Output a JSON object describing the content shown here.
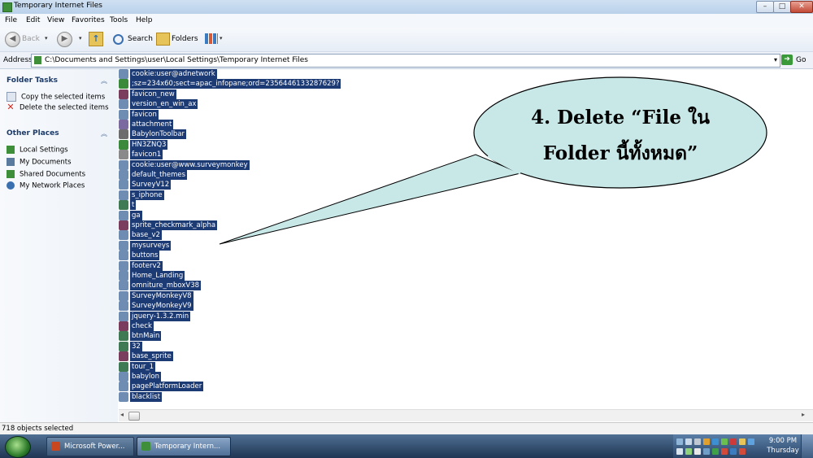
{
  "window": {
    "title": "Temporary Internet Files",
    "minimize_glyph": "–",
    "maximize_glyph": "□",
    "close_glyph": "✕"
  },
  "menu": [
    "File",
    "Edit",
    "View",
    "Favorites",
    "Tools",
    "Help"
  ],
  "toolbar": {
    "back_label": "Back",
    "back_glyph": "◀",
    "forward_glyph": "▶",
    "up_glyph": "↑",
    "search_label": "Search",
    "folders_label": "Folders",
    "dropdown_glyph": "▾"
  },
  "address": {
    "label": "Address",
    "value": "C:\\Documents and Settings\\user\\Local Settings\\Temporary Internet Files",
    "dropdown_glyph": "▾",
    "go_label": "Go",
    "go_glyph": "➜"
  },
  "left_pane": {
    "folder_tasks": {
      "title": "Folder Tasks",
      "chevron": "︽",
      "items": [
        {
          "label": "Copy the selected items",
          "icon": "copy-icon"
        },
        {
          "label": "Delete the selected items",
          "icon": "delete-icon"
        }
      ]
    },
    "other_places": {
      "title": "Other Places",
      "chevron": "︽",
      "items": [
        {
          "label": "Local Settings",
          "icon": "folder-icon"
        },
        {
          "label": "My Documents",
          "icon": "documents-icon"
        },
        {
          "label": "Shared Documents",
          "icon": "shared-folder-icon"
        },
        {
          "label": "My Network Places",
          "icon": "network-icon"
        }
      ]
    }
  },
  "files": [
    {
      "name": "cookie:user@adnetwork",
      "icon": "cookie-icon",
      "color": "#6f8db3"
    },
    {
      "name": ";sz=234x60;sect=apac_infopane;ord=2356446133287629?",
      "icon": "ie-icon",
      "color": "#3b8a3b"
    },
    {
      "name": "favicon_new",
      "icon": "image-icon",
      "color": "#7a3d5d"
    },
    {
      "name": "version_en_win_ax",
      "icon": "file-icon",
      "color": "#6f8db3"
    },
    {
      "name": "favicon",
      "icon": "file-icon",
      "color": "#6f8db3"
    },
    {
      "name": "attachment",
      "icon": "file-icon",
      "color": "#7a6aa0"
    },
    {
      "name": "BabylonToolbar",
      "icon": "file-icon",
      "color": "#6d6d6d"
    },
    {
      "name": "HN3ZNQ3",
      "icon": "ie-icon",
      "color": "#3b8a3b"
    },
    {
      "name": "favicon1",
      "icon": "file-icon",
      "color": "#8a8a8a"
    },
    {
      "name": "cookie:user@www.surveymonkey",
      "icon": "cookie-icon",
      "color": "#6f8db3"
    },
    {
      "name": "default_themes",
      "icon": "file-icon",
      "color": "#6f8db3"
    },
    {
      "name": "SurveyV12",
      "icon": "file-icon",
      "color": "#6f8db3"
    },
    {
      "name": "s_iphone",
      "icon": "file-icon",
      "color": "#6f8db3"
    },
    {
      "name": "t",
      "icon": "file-icon",
      "color": "#3f7a55"
    },
    {
      "name": "ga",
      "icon": "file-icon",
      "color": "#6f8db3"
    },
    {
      "name": "sprite_checkmark_alpha",
      "icon": "image-icon",
      "color": "#7a3d5d"
    },
    {
      "name": "base_v2",
      "icon": "file-icon",
      "color": "#6f8db3"
    },
    {
      "name": "mysurveys",
      "icon": "file-icon",
      "color": "#6f8db3"
    },
    {
      "name": "buttons",
      "icon": "file-icon",
      "color": "#6f8db3"
    },
    {
      "name": "footerv2",
      "icon": "file-icon",
      "color": "#6f8db3"
    },
    {
      "name": "Home_Landing",
      "icon": "file-icon",
      "color": "#6f8db3"
    },
    {
      "name": "omniture_mboxV38",
      "icon": "file-icon",
      "color": "#6f8db3"
    },
    {
      "name": "SurveyMonkeyV8",
      "icon": "file-icon",
      "color": "#6f8db3"
    },
    {
      "name": "SurveyMonkeyV9",
      "icon": "file-icon",
      "color": "#6f8db3"
    },
    {
      "name": "jquery-1.3.2.min",
      "icon": "file-icon",
      "color": "#6f8db3"
    },
    {
      "name": "check",
      "icon": "image-icon",
      "color": "#7a3d5d"
    },
    {
      "name": "btnMain",
      "icon": "file-icon",
      "color": "#3f7a55"
    },
    {
      "name": "32",
      "icon": "file-icon",
      "color": "#3f7a55"
    },
    {
      "name": "base_sprite",
      "icon": "image-icon",
      "color": "#7a3d5d"
    },
    {
      "name": "tour_1",
      "icon": "file-icon",
      "color": "#3f7a55"
    },
    {
      "name": "babylon",
      "icon": "file-icon",
      "color": "#6f8db3"
    },
    {
      "name": "pagePlatformLoader",
      "icon": "file-icon",
      "color": "#6f8db3"
    },
    {
      "name": "blacklist",
      "icon": "file-icon",
      "color": "#6f8db3"
    }
  ],
  "status": {
    "text": "718 objects selected"
  },
  "taskbar": {
    "tasks": [
      {
        "label": "Microsoft Power...",
        "icon": "powerpoint-icon",
        "color": "#c8471f",
        "active": false
      },
      {
        "label": "Temporary Intern...",
        "icon": "folder-icon",
        "color": "#3f8f3a",
        "active": true
      }
    ],
    "clock": {
      "time": "9:00 PM",
      "day": "Thursday"
    }
  },
  "callout": {
    "line1": "4. Delete “File ใน",
    "line2": "Folder นี้ทั้งหมด”",
    "fill": "#c8e8e8"
  }
}
